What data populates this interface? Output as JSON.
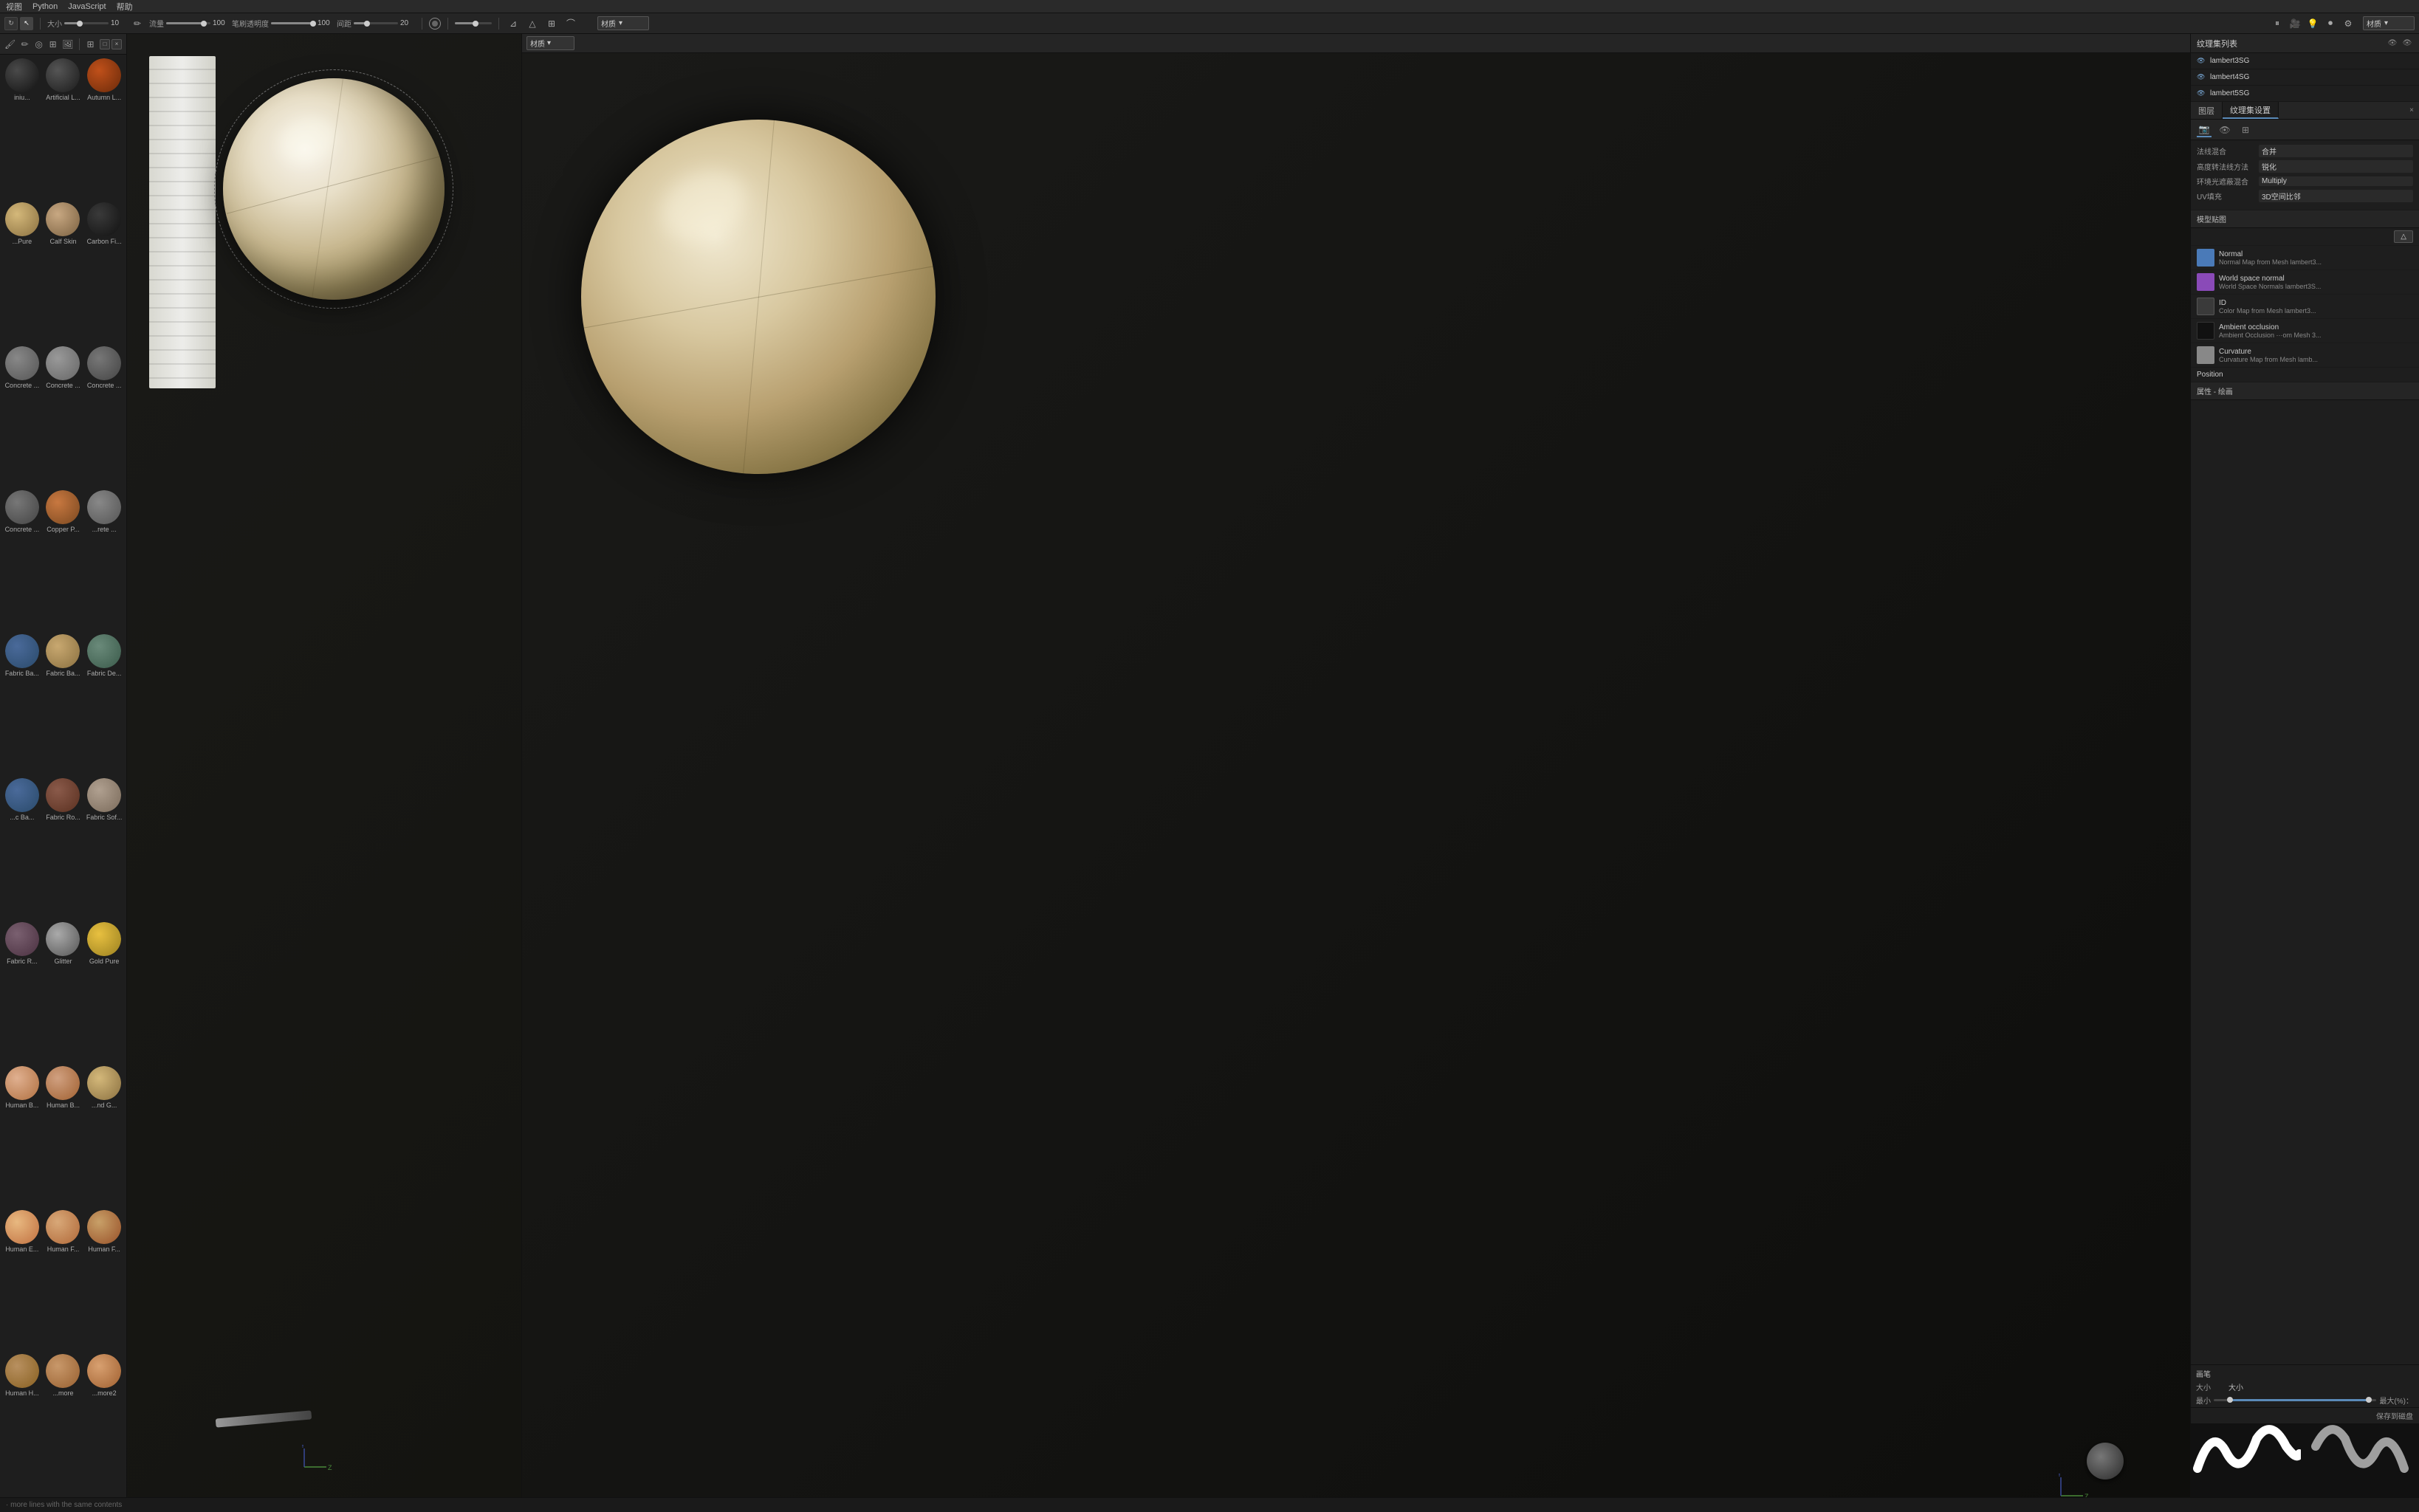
{
  "menu": {
    "items": [
      "视图",
      "Python",
      "JavaScript",
      "帮助"
    ]
  },
  "toolbar": {
    "size_label": "大小",
    "size_value": "10",
    "flow_label": "流量",
    "flow_value": "100",
    "opacity_label": "笔刷透明度",
    "opacity_value": "100",
    "spacing_label": "间距",
    "spacing_value": "20",
    "material_label": "材质",
    "dropdown1_value": "材质",
    "dropdown2_value": "材质"
  },
  "left_panel": {
    "materials": [
      {
        "name": "iniu...",
        "style": "mat-dark"
      },
      {
        "name": "Artificial L...",
        "style": "mat-charcoal"
      },
      {
        "name": "Autumn L...",
        "style": "mat-autumn"
      },
      {
        "name": "...Pure",
        "style": "mat-gold-pale"
      },
      {
        "name": "Calf Skin",
        "style": "mat-calf"
      },
      {
        "name": "Carbon Fi...",
        "style": "mat-carbon"
      },
      {
        "name": "Concrete ...",
        "style": "mat-concrete-light"
      },
      {
        "name": "Concrete ...",
        "style": "mat-concrete-mid"
      },
      {
        "name": "Concrete ...",
        "style": "mat-concrete-dark"
      },
      {
        "name": "Concrete ...",
        "style": "mat-concrete-dark"
      },
      {
        "name": "Copper P...",
        "style": "mat-copper"
      },
      {
        "name": "...rete ...",
        "style": "mat-concrete-light"
      },
      {
        "name": "Fabric Ba...",
        "style": "mat-fabric-blue"
      },
      {
        "name": "Fabric Ba...",
        "style": "mat-fabric-beige"
      },
      {
        "name": "Fabric De...",
        "style": "mat-fabric-de"
      },
      {
        "name": "...c Ba...",
        "style": "mat-fabric-blue"
      },
      {
        "name": "Fabric Ro...",
        "style": "mat-fabric-ro"
      },
      {
        "name": "Fabric Sof...",
        "style": "mat-fabric-soft"
      },
      {
        "name": "Fabric R...",
        "style": "mat-fabric-r"
      },
      {
        "name": "Glitter",
        "style": "mat-glitter"
      },
      {
        "name": "Gold Pure",
        "style": "mat-gold-pure"
      },
      {
        "name": "Human B...",
        "style": "mat-human-b1"
      },
      {
        "name": "Human B...",
        "style": "mat-human-b2"
      },
      {
        "name": "...nd G...",
        "style": "mat-gold-pale"
      },
      {
        "name": "Human E...",
        "style": "mat-human-e"
      },
      {
        "name": "Human F...",
        "style": "mat-human-f"
      },
      {
        "name": "Human F...",
        "style": "mat-human-f2"
      },
      {
        "name": "Human H...",
        "style": "mat-human-h"
      },
      {
        "name": "...more",
        "style": "mat-human-more"
      },
      {
        "name": "...more2",
        "style": "mat-human-more2"
      }
    ]
  },
  "texture_set_list": {
    "title": "纹理集列表",
    "items": [
      {
        "name": "lambert3SG",
        "active": false
      },
      {
        "name": "lambert4SG",
        "active": false
      },
      {
        "name": "lambert5SG",
        "active": false
      }
    ]
  },
  "settings_panel": {
    "tab1": "图层",
    "tab2": "纹理集设置",
    "properties": {
      "blend_mode_label": "法线混合",
      "blend_mode_value": "合并",
      "height_convert_label": "高度转法线方法",
      "height_convert_value": "锐化",
      "ao_blend_label": "环境光遮蔽混合",
      "ao_blend_value": "Multiply",
      "uv_fill_label": "UV填充",
      "uv_fill_value": "3D空间比邻"
    },
    "model_bake_title": "模型贴图",
    "bake_items": [
      {
        "name": "Normal",
        "sub": "Normal Map from Mesh lambert3...",
        "color": "#4a7ab8"
      },
      {
        "name": "World space normal",
        "sub": "World Space Normals lambert3S...",
        "color": "#8a4ab8"
      },
      {
        "name": "ID",
        "sub": "Color Map from Mesh lambert3...",
        "color": "#4a4a4a"
      },
      {
        "name": "Ambient occlusion",
        "sub": "Ambient Occlusion ···om Mesh 3...",
        "color": "#111"
      },
      {
        "name": "Curvature",
        "sub": "Curvature Map from Mesh lamb...",
        "color": "#888"
      },
      {
        "name": "Position",
        "sub": "",
        "color": "#1e1e1e"
      }
    ]
  },
  "paint_panel": {
    "title": "属性 - 绘画",
    "brush_label": "画笔",
    "size_label": "大小",
    "size_sub_label": "大小",
    "min_label": "最小",
    "max_label": "最大(%)：",
    "save_label": "保存到磁盘"
  },
  "status": {
    "text": "· more lines with the same contents"
  }
}
